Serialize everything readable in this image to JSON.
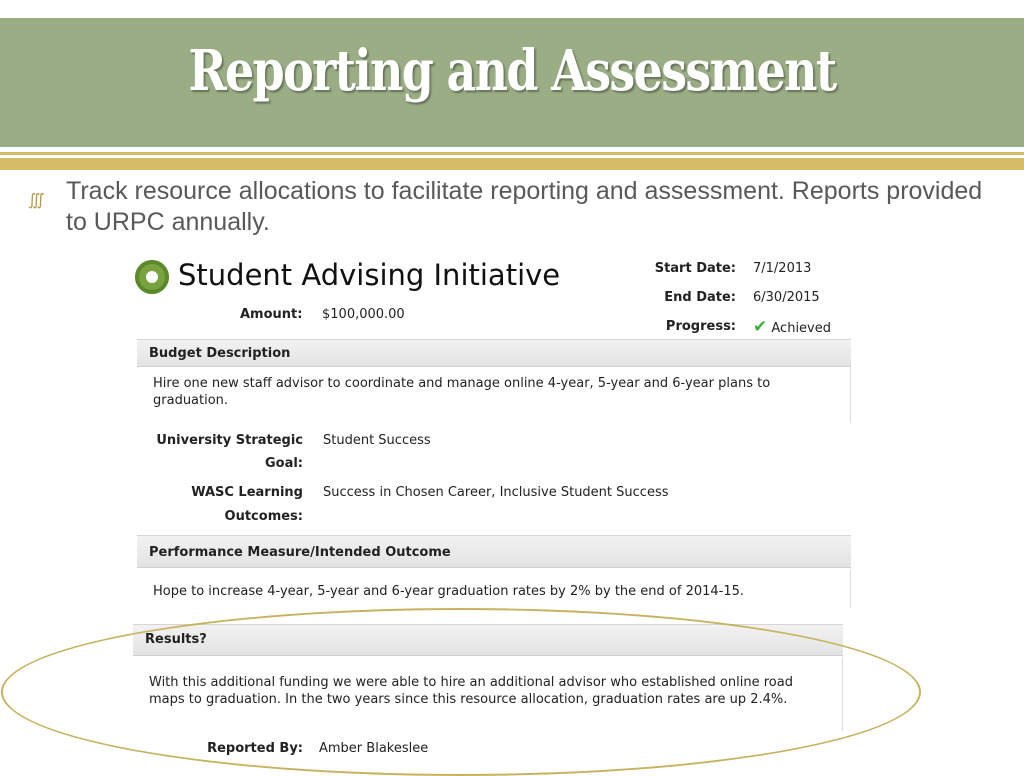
{
  "slide": {
    "title": "Reporting and Assessment",
    "bullet": "Track resource allocations to facilitate reporting and assessment.  Reports provided to URPC annually.",
    "colors": {
      "title_band": "#9aad85",
      "gold_accent": "#d4bd66",
      "oval": "#c9b25e"
    }
  },
  "record": {
    "title": "Student Advising Initiative",
    "icon": "gear-icon",
    "amount_label": "Amount:",
    "amount_value": "$100,000.00",
    "start_label": "Start Date:",
    "start_value": "7/1/2013",
    "end_label": "End Date:",
    "end_value": "6/30/2015",
    "progress_label": "Progress:",
    "progress_value": "Achieved",
    "budget_heading": "Budget Description",
    "budget_text": "Hire one new staff advisor to coordinate and manage online 4-year, 5-year and 6-year plans to graduation.",
    "goal_label_1": "University Strategic",
    "goal_label_2": "Goal:",
    "goal_value": "Student Success",
    "wasc_label_1": "WASC Learning",
    "wasc_label_2": "Outcomes:",
    "wasc_value": "Success in Chosen Career, Inclusive Student Success",
    "measure_heading": "Performance Measure/Intended Outcome",
    "measure_text": "Hope to increase 4-year, 5-year and 6-year graduation rates by 2% by the end of 2014-15.",
    "results_heading": "Results?",
    "results_text": "With this additional funding we were able to hire an additional advisor who established online road maps to graduation.  In the two years since this resource allocation, graduation rates are up 2.4%.",
    "reported_label": "Reported By:",
    "reported_value": "Amber Blakeslee"
  }
}
